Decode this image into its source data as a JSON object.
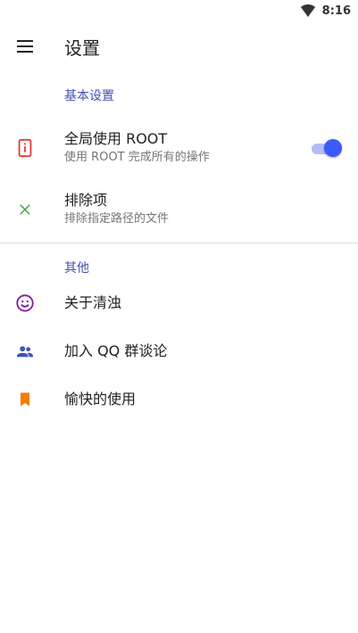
{
  "status_bar": {
    "time": "8:16",
    "wifi_icon": "wifi-icon"
  },
  "app_bar": {
    "menu_icon": "hamburger-menu-icon",
    "title": "设置"
  },
  "sections": {
    "basic": {
      "title": "基本设置",
      "items": [
        {
          "icon": "phone-info-icon",
          "icon_color": "#e53935",
          "label": "全局使用 ROOT",
          "sublabel": "使用 ROOT 完成所有的操作",
          "switch_on": true
        },
        {
          "icon": "close-x-icon",
          "icon_color": "#43a047",
          "label": "排除项",
          "sublabel": "排除指定路径的文件"
        }
      ]
    },
    "other": {
      "title": "其他",
      "items": [
        {
          "icon": "smiley-face-icon",
          "icon_color": "#7b1fa2",
          "label": "关于清浊"
        },
        {
          "icon": "people-group-icon",
          "icon_color": "#3f51b5",
          "label": "加入 QQ 群谈论"
        },
        {
          "icon": "bookmark-icon",
          "icon_color": "#f57c00",
          "label": "愉快的使用"
        }
      ]
    }
  },
  "colors": {
    "accent": "#3d5afe",
    "section_title": "#3f51b5",
    "switch_track": "#b3bdf5"
  }
}
